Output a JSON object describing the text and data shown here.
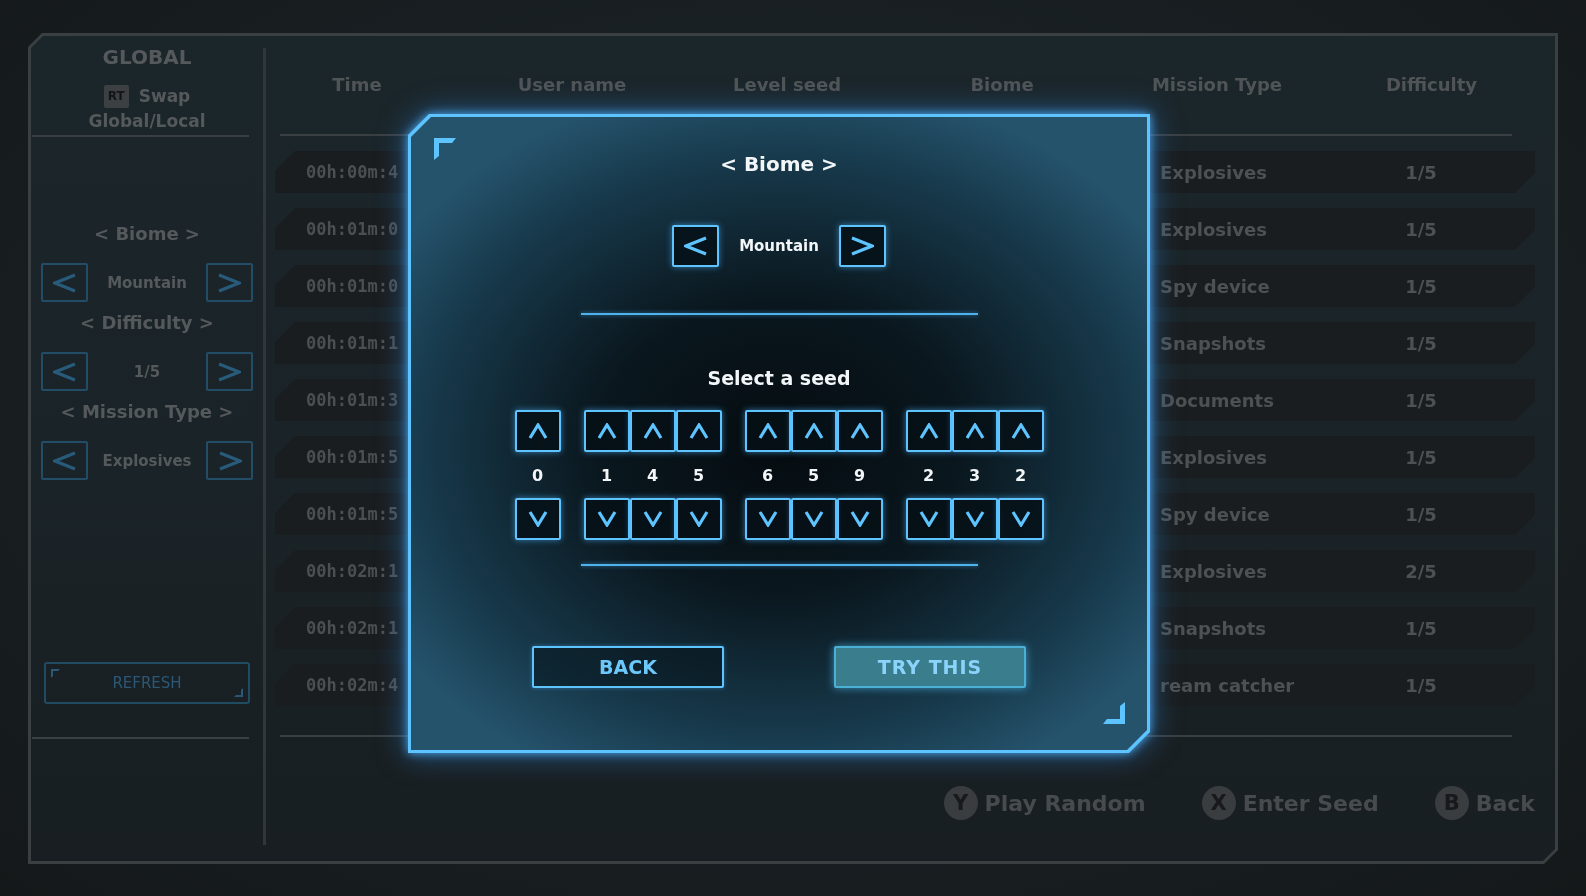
{
  "sidebar": {
    "title": "GLOBAL",
    "swap": {
      "key": "RT",
      "lines": [
        "Swap",
        "Global/Local"
      ]
    },
    "filters": [
      {
        "label": "< Biome >",
        "value": "Mountain"
      },
      {
        "label": "< Difficulty >",
        "value": "1/5"
      },
      {
        "label": "< Mission Type >",
        "value": "Explosives"
      }
    ],
    "refresh_button": "REFRESH"
  },
  "table": {
    "columns": [
      "Time",
      "User name",
      "Level seed",
      "Biome",
      "Mission Type",
      "Difficulty"
    ],
    "rows": [
      {
        "time": "00h:00m:4",
        "mission_type": "Explosives",
        "difficulty": "1/5"
      },
      {
        "time": "00h:01m:0",
        "mission_type": "Explosives",
        "difficulty": "1/5"
      },
      {
        "time": "00h:01m:0",
        "mission_type": "Spy device",
        "difficulty": "1/5"
      },
      {
        "time": "00h:01m:1",
        "mission_type": "Snapshots",
        "difficulty": "1/5"
      },
      {
        "time": "00h:01m:3",
        "mission_type": "Documents",
        "difficulty": "1/5"
      },
      {
        "time": "00h:01m:5",
        "mission_type": "Explosives",
        "difficulty": "1/5"
      },
      {
        "time": "00h:01m:5",
        "mission_type": "Spy device",
        "difficulty": "1/5"
      },
      {
        "time": "00h:02m:1",
        "mission_type": "Explosives",
        "difficulty": "2/5"
      },
      {
        "time": "00h:02m:1",
        "mission_type": "Snapshots",
        "difficulty": "1/5"
      },
      {
        "time": "00h:02m:4",
        "mission_type": "ream catcher",
        "difficulty": "1/5"
      }
    ]
  },
  "dialog": {
    "title": "< Biome >",
    "value": "Mountain",
    "prompt": "Select a seed",
    "seed_groups": [
      {
        "digits": [
          "0"
        ]
      },
      {
        "digits": [
          "1",
          "4",
          "5"
        ]
      },
      {
        "digits": [
          "6",
          "5",
          "9"
        ]
      },
      {
        "digits": [
          "2",
          "3",
          "2"
        ]
      }
    ],
    "buttons": [
      {
        "label": "BACK",
        "selected": false
      },
      {
        "label": "TRY THIS",
        "selected": true
      }
    ]
  },
  "controller_hints": [
    {
      "key": "Y",
      "label": "Play Random"
    },
    {
      "key": "X",
      "label": "Enter Seed"
    },
    {
      "key": "B",
      "label": "Back"
    }
  ]
}
